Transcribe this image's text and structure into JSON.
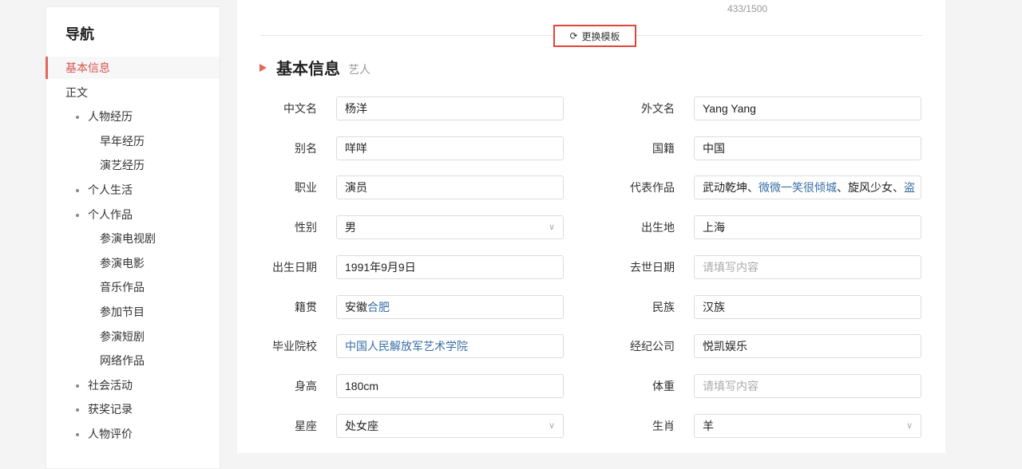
{
  "sidebar": {
    "title": "导航",
    "items": [
      {
        "label": "基本信息",
        "level": 0,
        "active": true
      },
      {
        "label": "正文",
        "level": 0
      },
      {
        "label": "人物经历",
        "level": 1
      },
      {
        "label": "早年经历",
        "level": 2
      },
      {
        "label": "演艺经历",
        "level": 2
      },
      {
        "label": "个人生活",
        "level": 1
      },
      {
        "label": "个人作品",
        "level": 1
      },
      {
        "label": "参演电视剧",
        "level": 2
      },
      {
        "label": "参演电影",
        "level": 2
      },
      {
        "label": "音乐作品",
        "level": 2
      },
      {
        "label": "参加节目",
        "level": 2
      },
      {
        "label": "参演短剧",
        "level": 2
      },
      {
        "label": "网络作品",
        "level": 2
      },
      {
        "label": "社会活动",
        "level": 1
      },
      {
        "label": "获奖记录",
        "level": 1
      },
      {
        "label": "人物评价",
        "level": 1
      }
    ]
  },
  "main": {
    "counter": "433/1500",
    "swap_button": "更换模板",
    "section_title": "基本信息",
    "section_subtitle": "艺人",
    "placeholder": "请填写内容",
    "rows": [
      [
        {
          "label": "中文名",
          "segments": [
            {
              "t": "杨洋"
            }
          ]
        },
        {
          "label": "外文名",
          "segments": [
            {
              "t": "Yang Yang"
            }
          ]
        }
      ],
      [
        {
          "label": "别名",
          "segments": [
            {
              "t": "咩咩"
            }
          ]
        },
        {
          "label": "国籍",
          "segments": [
            {
              "t": "中国"
            }
          ]
        }
      ],
      [
        {
          "label": "职业",
          "segments": [
            {
              "t": "演员"
            }
          ]
        },
        {
          "label": "代表作品",
          "segments": [
            {
              "t": "武动乾坤、"
            },
            {
              "t": "微微一笑很倾城",
              "link": true
            },
            {
              "t": "、旋风少女、"
            },
            {
              "t": "盗",
              "link": true
            }
          ]
        }
      ],
      [
        {
          "label": "性别",
          "segments": [
            {
              "t": "男"
            }
          ],
          "select": true
        },
        {
          "label": "出生地",
          "segments": [
            {
              "t": "上海"
            }
          ]
        }
      ],
      [
        {
          "label": "出生日期",
          "segments": [
            {
              "t": "1991年9月9日"
            }
          ]
        },
        {
          "label": "去世日期",
          "segments": []
        }
      ],
      [
        {
          "label": "籍贯",
          "segments": [
            {
              "t": "安徽"
            },
            {
              "t": "合肥",
              "link": true
            }
          ]
        },
        {
          "label": "民族",
          "segments": [
            {
              "t": "汉族"
            }
          ]
        }
      ],
      [
        {
          "label": "毕业院校",
          "segments": [
            {
              "t": "中国人民解放军艺术学院",
              "link": true
            }
          ]
        },
        {
          "label": "经纪公司",
          "segments": [
            {
              "t": "悦凯娱乐"
            }
          ]
        }
      ],
      [
        {
          "label": "身高",
          "segments": [
            {
              "t": "180cm"
            }
          ]
        },
        {
          "label": "体重",
          "segments": []
        }
      ],
      [
        {
          "label": "星座",
          "segments": [
            {
              "t": "处女座"
            }
          ],
          "select": true
        },
        {
          "label": "生肖",
          "segments": [
            {
              "t": "羊"
            }
          ],
          "select": true
        }
      ]
    ]
  }
}
